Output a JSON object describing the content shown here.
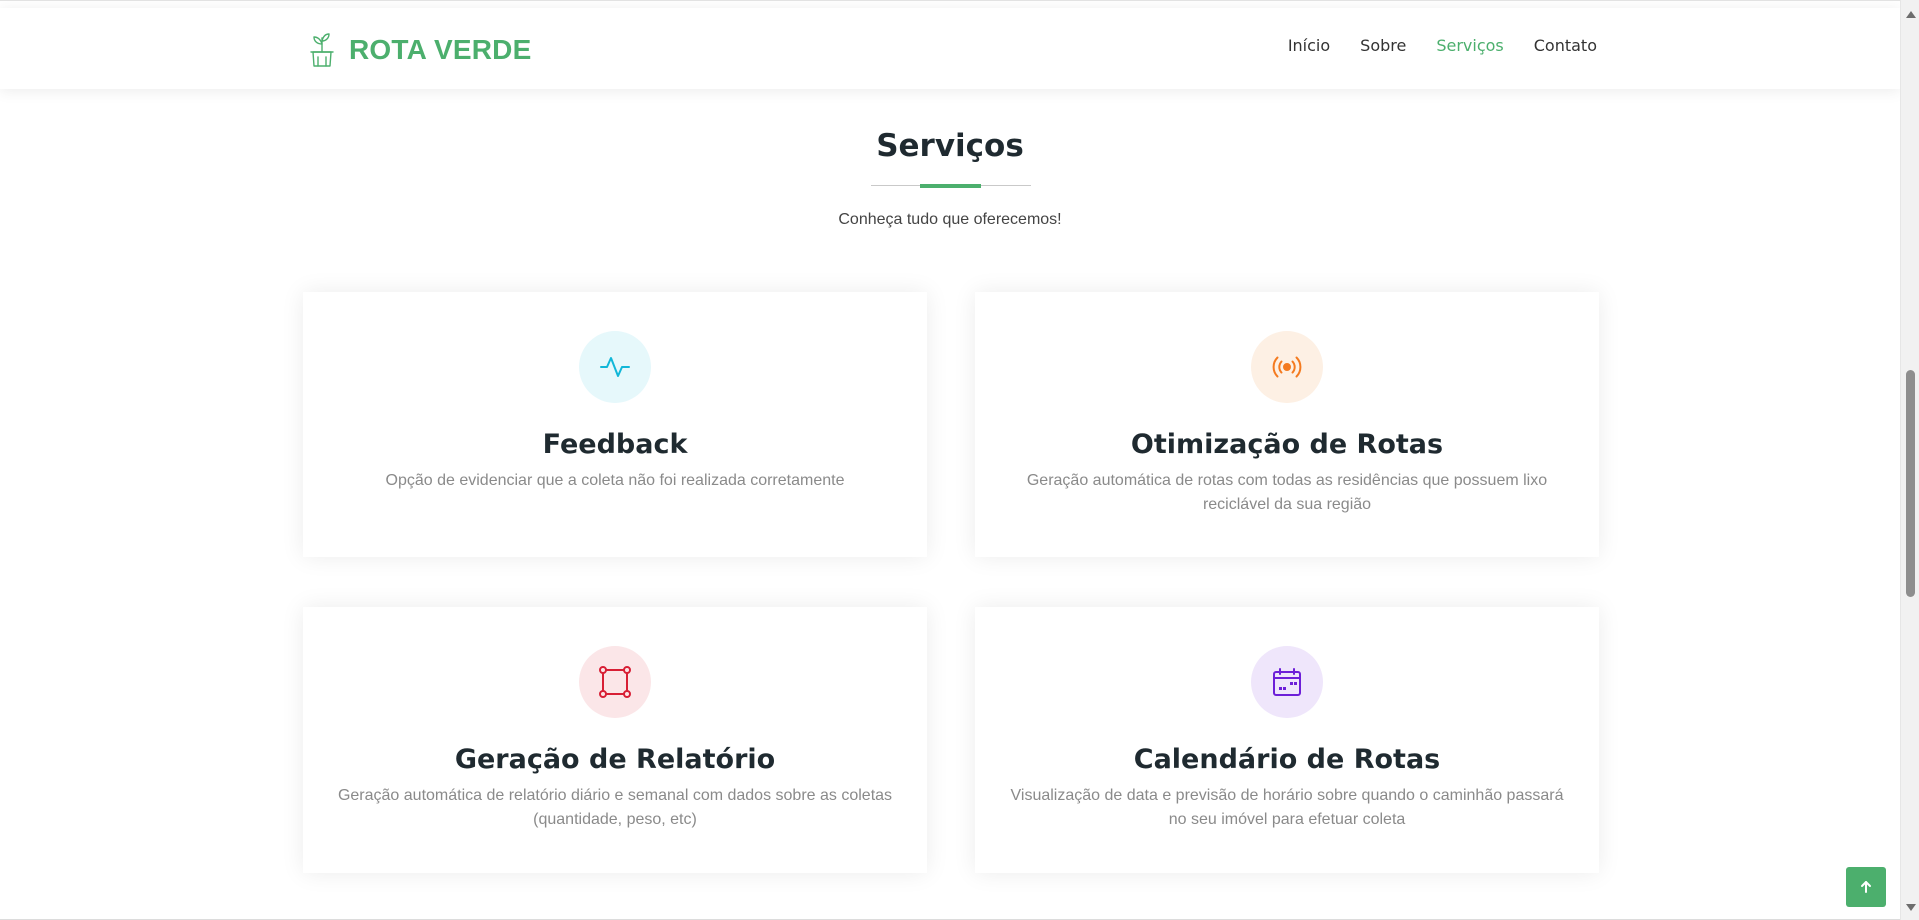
{
  "brand": {
    "name": "ROTA VERDE",
    "icon": "plant-box-icon",
    "color": "#4caf6d"
  },
  "nav": [
    {
      "label": "Início",
      "active": false
    },
    {
      "label": "Sobre",
      "active": false
    },
    {
      "label": "Serviços",
      "active": true
    },
    {
      "label": "Contato",
      "active": false
    }
  ],
  "section": {
    "title": "Serviços",
    "subtitle": "Conheça tudo que oferecemos!"
  },
  "services": [
    {
      "icon": "activity-pulse-icon",
      "icon_color": "#11b7d8",
      "icon_bg": "#e6f8fb",
      "title": "Feedback",
      "description": "Opção de evidenciar que a coleta não foi realizada corretamente"
    },
    {
      "icon": "broadcast-icon",
      "icon_color": "#f47a1f",
      "icon_bg": "#fdf0e4",
      "title": "Otimização de Rotas",
      "description": "Geração automática de rotas com todas as residências que possuem lixo reciclável da sua região"
    },
    {
      "icon": "bounding-box-icon",
      "icon_color": "#d81f35",
      "icon_bg": "#fbe6e8",
      "title": "Geração de Relatório",
      "description": "Geração automática de relatório diário e semanal com dados sobre as coletas (quantidade, peso, etc)"
    },
    {
      "icon": "calendar-icon",
      "icon_color": "#6d1fd8",
      "icon_bg": "#efe6fb",
      "title": "Calendário de Rotas",
      "description": "Visualização de data e previsão de horário sobre quando o caminhão passará no seu imóvel para efetuar coleta"
    }
  ],
  "back_to_top": {
    "icon": "arrow-up-icon"
  }
}
